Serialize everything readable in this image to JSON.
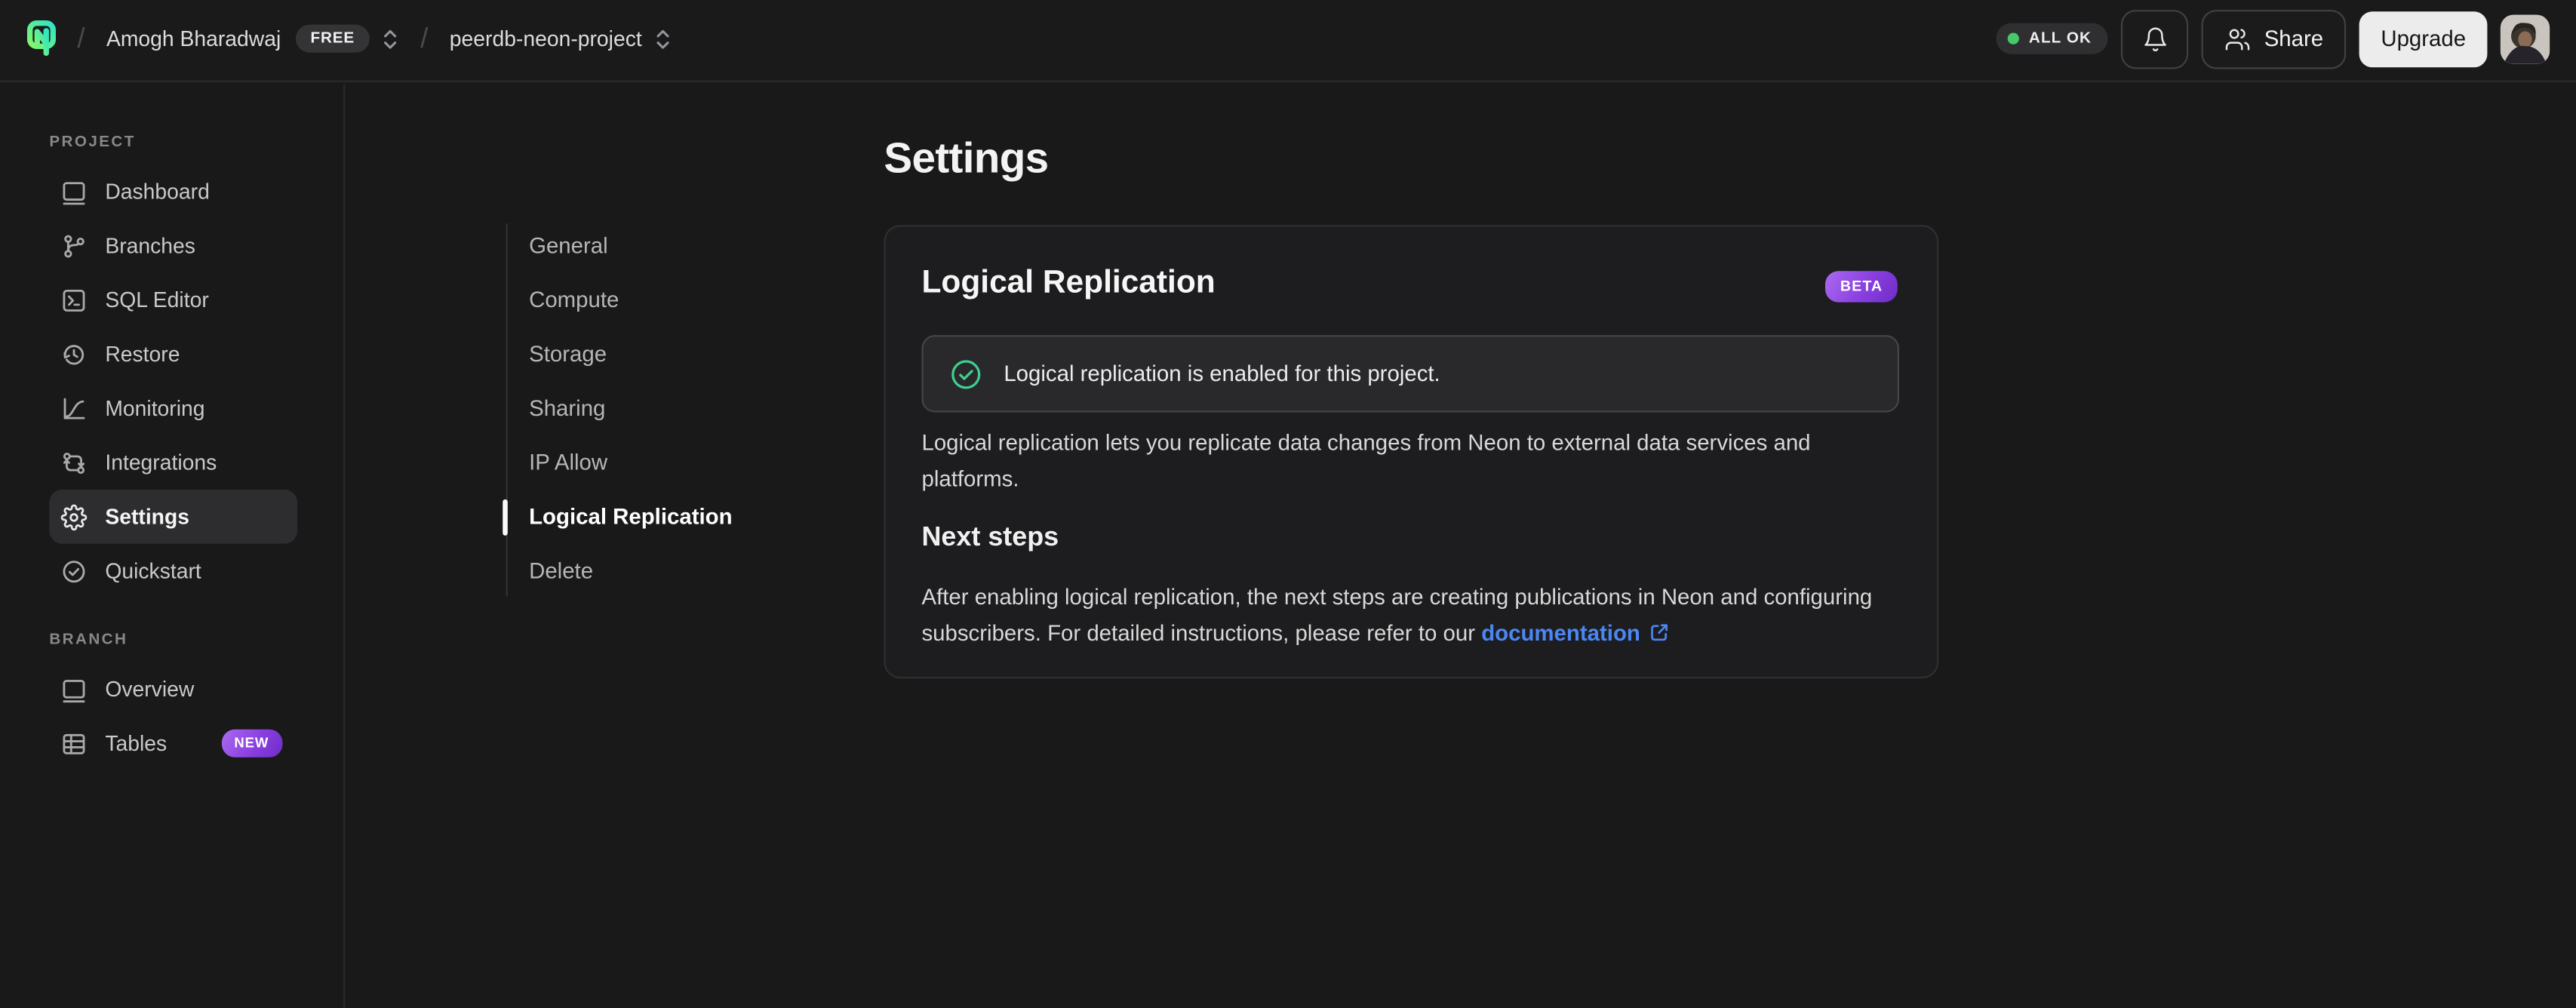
{
  "topbar": {
    "separator": "/",
    "org": "Amogh Bharadwaj",
    "plan_badge": "FREE",
    "project": "peerdb-neon-project",
    "status": "ALL OK",
    "share_label": "Share",
    "upgrade_label": "Upgrade"
  },
  "sidebar": {
    "project_label": "PROJECT",
    "project_items": [
      {
        "label": "Dashboard",
        "icon": "dashboard-icon"
      },
      {
        "label": "Branches",
        "icon": "branches-icon"
      },
      {
        "label": "SQL Editor",
        "icon": "sql-editor-icon"
      },
      {
        "label": "Restore",
        "icon": "restore-icon"
      },
      {
        "label": "Monitoring",
        "icon": "monitoring-icon"
      },
      {
        "label": "Integrations",
        "icon": "integrations-icon"
      },
      {
        "label": "Settings",
        "icon": "gear-icon",
        "active": true
      },
      {
        "label": "Quickstart",
        "icon": "check-circle-icon"
      }
    ],
    "branch_label": "BRANCH",
    "branch_items": [
      {
        "label": "Overview",
        "icon": "window-icon"
      },
      {
        "label": "Tables",
        "icon": "tables-icon",
        "badge": "NEW"
      }
    ],
    "new_badge": "NEW"
  },
  "main": {
    "title": "Settings",
    "nav": [
      "General",
      "Compute",
      "Storage",
      "Sharing",
      "IP Allow",
      "Logical Replication",
      "Delete"
    ],
    "active_nav": "Logical Replication",
    "card": {
      "title": "Logical Replication",
      "beta_badge": "BETA",
      "alert_text": "Logical replication is enabled for this project.",
      "description_line1": "Logical replication lets you replicate data changes from Neon to external data services and",
      "description_line2": "platforms.",
      "next_steps_title": "Next steps",
      "next_steps_line1": "After enabling logical replication, the next steps are creating publications in Neon and configuring",
      "next_steps_line2_prefix": "subscribers. For detailed instructions, please refer to our",
      "doc_link_label": "documentation"
    }
  },
  "colors": {
    "background": "#191919",
    "card_background": "#1d1d1f",
    "brand_green": "#63eb67",
    "brand_teal": "#2ee5c4",
    "status_green": "#45c96a",
    "success_green": "#3ecf8e",
    "badge_purple_start": "#aa6af0",
    "badge_purple_end": "#6f2dc7",
    "link_blue": "#4b87f2"
  }
}
